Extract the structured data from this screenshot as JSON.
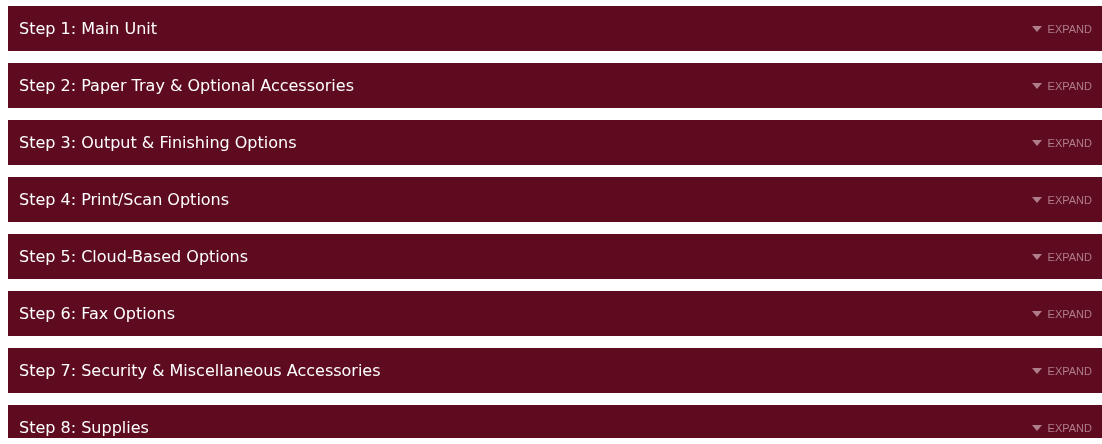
{
  "sections": [
    {
      "title": "Step 1: Main Unit",
      "toggle": "EXPAND",
      "expanded": false
    },
    {
      "title": "Step 2: Paper Tray & Optional Accessories",
      "toggle": "EXPAND",
      "expanded": false
    },
    {
      "title": "Step 3: Output & Finishing Options",
      "toggle": "EXPAND",
      "expanded": false
    },
    {
      "title": "Step 4: Print/Scan Options",
      "toggle": "EXPAND",
      "expanded": false
    },
    {
      "title": "Step 5: Cloud-Based Options",
      "toggle": "EXPAND",
      "expanded": false
    },
    {
      "title": "Step 6: Fax Options",
      "toggle": "EXPAND",
      "expanded": false
    },
    {
      "title": "Step 7: Security & Miscellaneous Accessories",
      "toggle": "EXPAND",
      "expanded": false
    },
    {
      "title": "Step 8: Supplies",
      "toggle": "EXPAND",
      "expanded": false
    }
  ]
}
